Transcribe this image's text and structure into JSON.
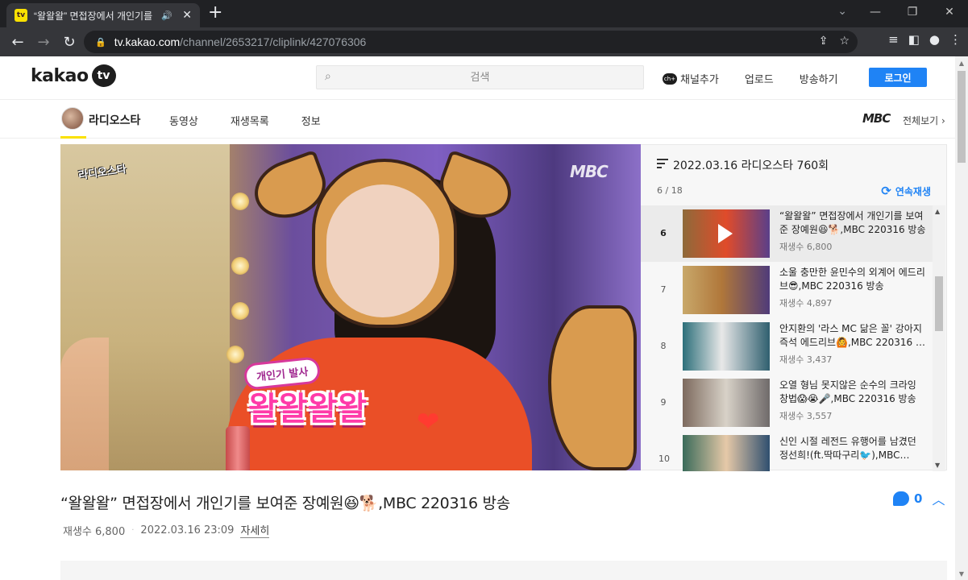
{
  "browser": {
    "tab_title": "“왈왈왈” 면접장에서 개인기를 보여준 장예원",
    "favicon_text": "tv",
    "url_host": "tv.kakao.com",
    "url_path": "/channel/2653217/cliplink/427076306"
  },
  "header": {
    "logo_text": "kakao",
    "logo_badge": "tv",
    "search_placeholder": "검색",
    "menu": [
      {
        "label": "채널추가"
      },
      {
        "label": "업로드"
      },
      {
        "label": "방송하기"
      }
    ],
    "login_label": "로그인"
  },
  "channel": {
    "name": "라디오스타",
    "tabs": [
      "동영상",
      "재생목록",
      "정보"
    ],
    "broadcaster": "MBC",
    "view_all": "전체보기"
  },
  "video": {
    "show_logo": "라디오스타",
    "watermark": "MBC",
    "caption_small": "개인기 발사",
    "caption_big": "왈왈왈왈"
  },
  "playlist": {
    "title": "2022.03.16 라디오스타 760회",
    "count": "6 / 18",
    "autoplay_label": "연속재생",
    "items": [
      {
        "num": "6",
        "title": "“왈왈왈” 면접장에서 개인기를 보여준 장예원😆🐕,MBC 220316 방송",
        "views": "재생수 6,800",
        "active": true,
        "thumb": "#8e6a3a"
      },
      {
        "num": "7",
        "title": "소울 충만한 윤민수의 외계어 에드리브😎,MBC 220316 방송",
        "views": "재생수 4,897",
        "active": false,
        "thumb": "#b0773a"
      },
      {
        "num": "8",
        "title": "안지환의 '라스 MC 닮은 꼴' 강아지 즉석 에드리브🙆,MBC 220316 …",
        "views": "재생수 3,437",
        "active": false,
        "thumb": "#2c6f7a"
      },
      {
        "num": "9",
        "title": "오열 형님 못지않은 순수의 크라잉 창법😱😭🎤,MBC 220316 방송",
        "views": "재생수 3,557",
        "active": false,
        "thumb": "#7d6a5e"
      },
      {
        "num": "10",
        "title": "신인 시절 레전드 유행어를 남겼던 정선희!(ft.딱따구리🐦),MBC…",
        "views": "",
        "active": false,
        "thumb": "#3a6b5a"
      }
    ]
  },
  "info": {
    "title": "“왈왈왈” 면접장에서 개인기를 보여준 장예원😆🐕,MBC 220316 방송",
    "views": "재생수 6,800",
    "date": "2022.03.16 23:09",
    "detail_label": "자세히",
    "comment_count": "0"
  }
}
